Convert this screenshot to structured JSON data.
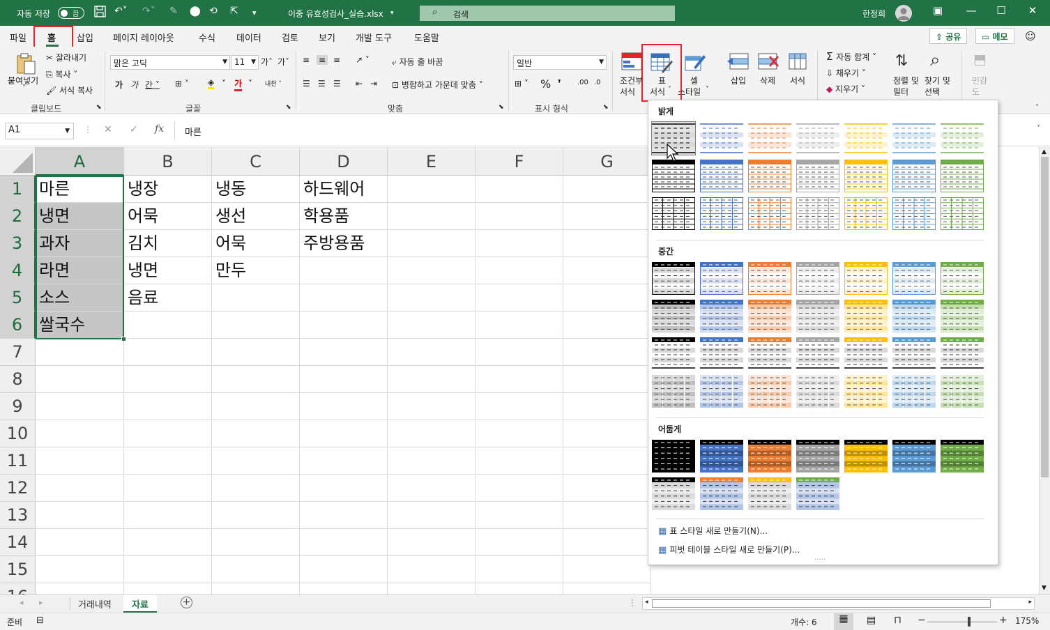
{
  "titlebar": {
    "autosave_label": "자동 저장",
    "autosave_state": "끔",
    "filename": "이중 유효성검사_실습.xlsx",
    "search_placeholder": "검색",
    "user_name": "한정희"
  },
  "menu": {
    "tabs": [
      "파일",
      "홈",
      "삽입",
      "페이지 레이아웃",
      "수식",
      "데이터",
      "검토",
      "보기",
      "개발 도구",
      "도움말"
    ],
    "share": "공유",
    "memo": "메모"
  },
  "ribbon": {
    "clipboard": {
      "paste": "붙여넣기",
      "cut": "잘라내기",
      "copy": "복사",
      "format_painter": "서식 복사",
      "group": "클립보드"
    },
    "font": {
      "name": "맑은 고딕",
      "size": "11",
      "group": "글꼴"
    },
    "alignment": {
      "wrap": "자동 줄 바꿈",
      "merge": "병합하고 가운데 맞춤",
      "group": "맞춤"
    },
    "number": {
      "format": "일반",
      "group": "표시 형식"
    },
    "styles": {
      "conditional_line1": "조건부",
      "conditional_line2": "서식",
      "table_line1": "표",
      "table_line2": "서식",
      "cell_line1": "셀",
      "cell_line2": "스타일"
    },
    "cells": {
      "insert": "삽입",
      "delete": "삭제",
      "format": "서식"
    },
    "editing": {
      "autosum": "자동 합계",
      "fill": "채우기",
      "clear": "지우기",
      "sort_line1": "정렬 및",
      "sort_line2": "필터",
      "find_line1": "찾기 및",
      "find_line2": "선택"
    },
    "sensitivity": {
      "line1": "민감",
      "line2": "도"
    }
  },
  "formula_bar": {
    "name_box": "A1",
    "content": "마른"
  },
  "columns": [
    "A",
    "B",
    "C",
    "D",
    "E",
    "F",
    "G"
  ],
  "rows": [
    "1",
    "2",
    "3",
    "4",
    "5",
    "6",
    "7",
    "8",
    "9",
    "10",
    "11",
    "12",
    "13",
    "14",
    "15",
    "16"
  ],
  "cells": {
    "A": [
      "마른",
      "냉면",
      "과자",
      "라면",
      "소스",
      "쌀국수"
    ],
    "B": [
      "냉장",
      "어묵",
      "김치",
      "냉면",
      "음료"
    ],
    "C": [
      "냉동",
      "생선",
      "어묵",
      "만두"
    ],
    "D": [
      "하드웨어",
      "학용품",
      "주방용품"
    ]
  },
  "sheets": [
    "거래내역",
    "자료"
  ],
  "active_sheet": "자료",
  "status": {
    "ready": "준비",
    "count": "개수: 6",
    "zoom": "175%"
  },
  "gallery": {
    "light_label": "밝게",
    "medium_label": "중간",
    "dark_label": "어둡게",
    "new_table_style": "표 스타일 새로 만들기(N)...",
    "new_pivot_style": "피벗 테이블 스타일 새로 만들기(P)...",
    "palette": [
      "#000000",
      "#4472c4",
      "#ed7d31",
      "#a5a5a5",
      "#ffc000",
      "#5b9bd5",
      "#70ad47"
    ],
    "light_tints": [
      "#d9d9d9",
      "#d9e1f2",
      "#fce4d6",
      "#ededed",
      "#fff2cc",
      "#ddebf7",
      "#e2efda"
    ],
    "medium_tints": [
      "#bfbfbf",
      "#b4c6e7",
      "#f8cbad",
      "#dbdbdb",
      "#ffe699",
      "#bdd7ee",
      "#c6e0b4"
    ]
  }
}
